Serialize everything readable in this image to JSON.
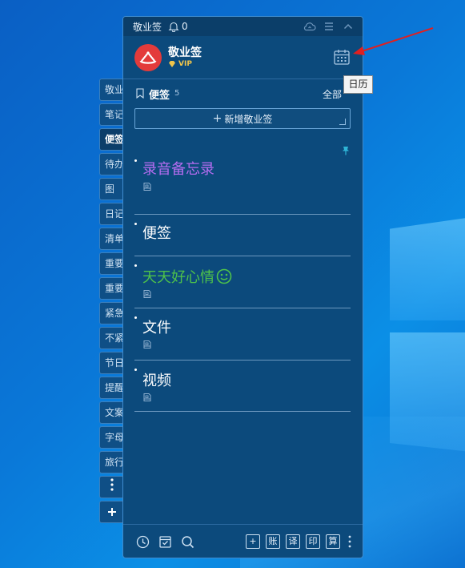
{
  "window": {
    "title": "敬业签",
    "reminder_count": "0"
  },
  "header": {
    "app_name": "敬业签",
    "vip_label": "VIP"
  },
  "tooltip": "日历",
  "side_tabs": [
    "敬业",
    "笔记",
    "便签",
    "待办",
    "图",
    "日记",
    "清单",
    "重要",
    "重要",
    "紧急",
    "不紧",
    "节日",
    "提醒",
    "文案",
    "字母",
    "旅行"
  ],
  "active_tab_index": 2,
  "note_list": {
    "title": "便签",
    "count": "5",
    "filter": "全部",
    "new_button": "新增敬业签"
  },
  "notes": [
    {
      "title": "录音备忘录",
      "color": "#b46cf0"
    },
    {
      "title": "便签",
      "color": "#ffffff"
    },
    {
      "title": "天天好心情",
      "color": "#4ec24a"
    },
    {
      "title": "文件",
      "color": "#ffffff"
    },
    {
      "title": "视频",
      "color": "#ffffff"
    }
  ],
  "footer": {
    "buttons": [
      "账",
      "译",
      "印",
      "算"
    ]
  },
  "icons": {
    "titlebar": [
      "bell-icon",
      "cloud-sync-icon",
      "menu-icon",
      "collapse-icon"
    ],
    "header": [
      "calendar-icon"
    ],
    "footer": [
      "clock-icon",
      "archive-icon",
      "search-icon",
      "add-icon",
      "more-icon"
    ]
  }
}
